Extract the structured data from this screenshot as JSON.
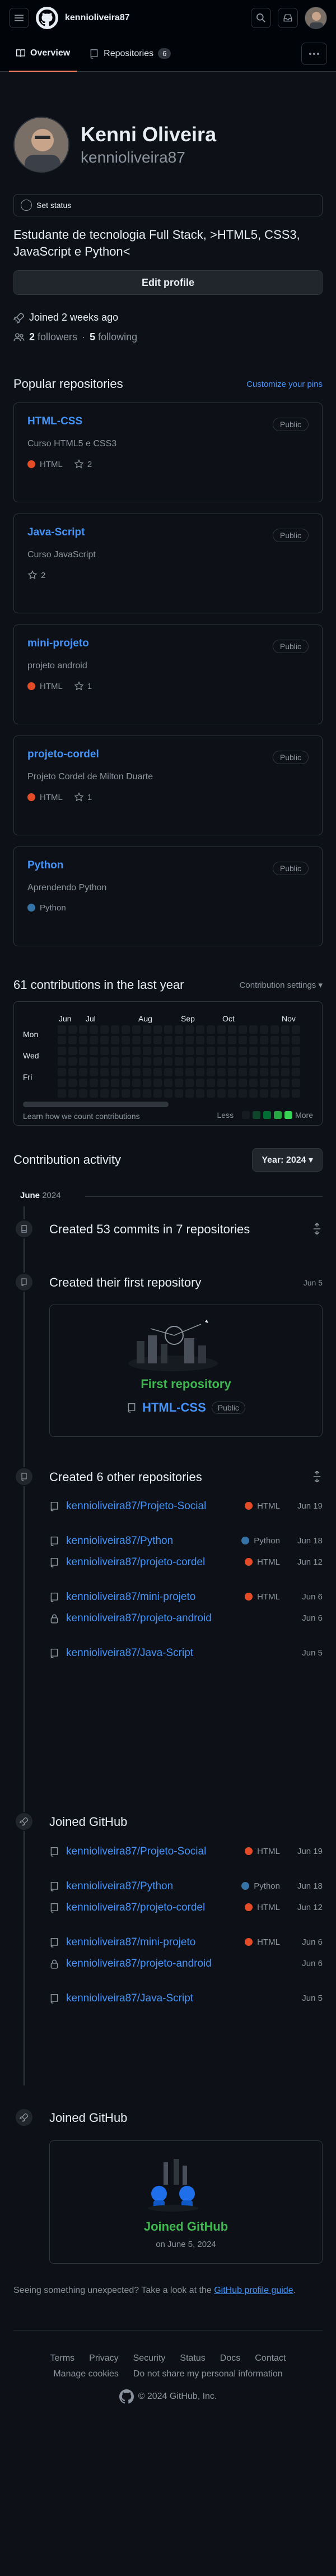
{
  "header": {
    "username": "kennioliveira87",
    "menu_icon": "hamburger-icon",
    "logo_icon": "github-logo-icon",
    "search_icon": "search-icon",
    "inbox_icon": "inbox-icon"
  },
  "tabs": [
    {
      "label": "Overview",
      "icon": "book-icon",
      "active": true
    },
    {
      "label": "Repositories",
      "icon": "repo-icon",
      "count": "6"
    }
  ],
  "profile": {
    "name": "Kenni Oliveira",
    "login": "kennioliveira87",
    "status": "Set status",
    "bio": "Estudante de tecnologia Full Stack, >HTML5, CSS3, JavaScript e Python<",
    "edit_label": "Edit profile",
    "joined": "Joined 2 weeks ago",
    "followers_count": "2",
    "followers_label": "followers",
    "following_count": "5",
    "following_label": "following",
    "separator": "·"
  },
  "popular": {
    "title": "Popular repositories",
    "customize": "Customize your pins",
    "repos": [
      {
        "name": "HTML-CSS",
        "visibility": "Public",
        "desc": "Curso HTML5 e CSS3",
        "lang": "HTML",
        "lang_color": "#e34c26",
        "stars": "2"
      },
      {
        "name": "Java-Script",
        "visibility": "Public",
        "desc": "Curso JavaScript",
        "lang": "",
        "lang_color": "",
        "stars": "2"
      },
      {
        "name": "mini-projeto",
        "visibility": "Public",
        "desc": "projeto android",
        "lang": "HTML",
        "lang_color": "#e34c26",
        "stars": "1"
      },
      {
        "name": "projeto-cordel",
        "visibility": "Public",
        "desc": "Projeto Cordel de Milton Duarte",
        "lang": "HTML",
        "lang_color": "#e34c26",
        "stars": "1"
      },
      {
        "name": "Python",
        "visibility": "Public",
        "desc": "Aprendendo Python",
        "lang": "Python",
        "lang_color": "#3572a5",
        "stars": ""
      }
    ]
  },
  "contributions": {
    "title": "61 contributions in the last year",
    "settings": "Contribution settings",
    "months": [
      "Jun",
      "Jul",
      "Aug",
      "Sep",
      "Oct",
      "Nov"
    ],
    "days": [
      "Mon",
      "Wed",
      "Fri"
    ],
    "learn": "Learn how we count contributions",
    "less": "Less",
    "more": "More",
    "legend_colors": [
      "#161b22",
      "#0e4429",
      "#006d32",
      "#26a641",
      "#39d353"
    ]
  },
  "activity": {
    "title": "Contribution activity",
    "year_label": "Year: 2024",
    "month": "June",
    "month_year": "2024",
    "commits": "Created 53 commits in 7 repositories",
    "first_repo_title": "Created their first repository",
    "first_repo_date": "Jun 5",
    "first_repo_caption": "First repository",
    "first_repo_name": "HTML-CSS",
    "first_repo_badge": "Public",
    "other_title": "Created 6 other repositories",
    "other_repos": [
      {
        "name": "kennioliveira87/Projeto-Social",
        "lang": "HTML",
        "color": "#e34c26",
        "date": "Jun 19",
        "icon": "repo-icon"
      },
      {
        "name": "kennioliveira87/Python",
        "lang": "Python",
        "color": "#3572a5",
        "date": "Jun 18",
        "icon": "repo-icon"
      },
      {
        "name": "kennioliveira87/projeto-cordel",
        "lang": "HTML",
        "color": "#e34c26",
        "date": "Jun 12",
        "icon": "repo-icon"
      },
      {
        "name": "kennioliveira87/mini-projeto",
        "lang": "HTML",
        "color": "#e34c26",
        "date": "Jun 6",
        "icon": "repo-icon"
      },
      {
        "name": "kennioliveira87/projeto-android",
        "lang": "",
        "color": "",
        "date": "Jun 6",
        "icon": "lock-icon"
      },
      {
        "name": "kennioliveira87/Java-Script",
        "lang": "",
        "color": "",
        "date": "Jun 5",
        "icon": "repo-icon"
      }
    ],
    "joined_title": "Joined GitHub",
    "joined_caption": "Joined GitHub",
    "joined_date": "on June 5, 2024"
  },
  "unexpected": {
    "text": "Seeing something unexpected? Take a look at the ",
    "link": "GitHub profile guide",
    "end": "."
  },
  "footer": {
    "links": [
      "Terms",
      "Privacy",
      "Security",
      "Status",
      "Docs",
      "Contact"
    ],
    "links2": [
      "Manage cookies",
      "Do not share my personal information"
    ],
    "copyright": "© 2024 GitHub, Inc."
  }
}
